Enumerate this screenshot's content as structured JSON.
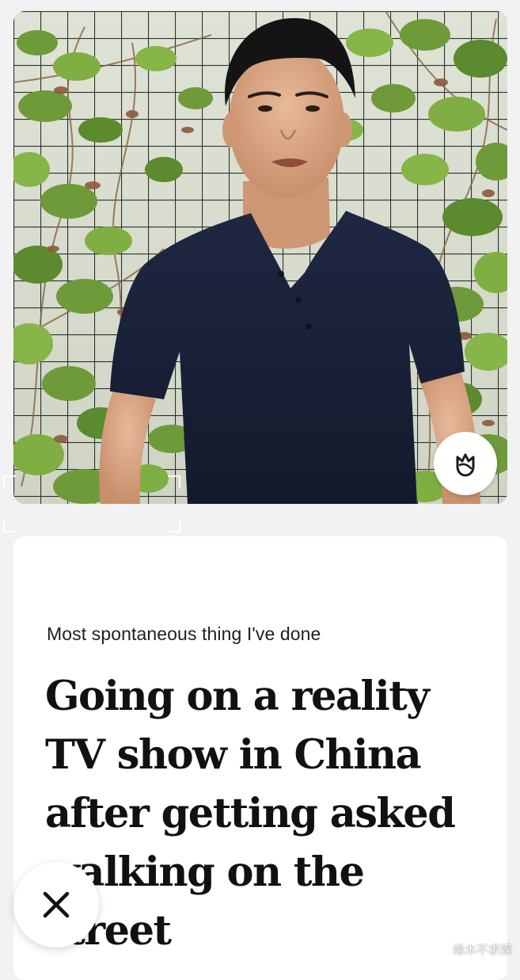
{
  "profile": {
    "photo": {
      "description_icon": "profile-photo",
      "like_icon": "rose-icon"
    },
    "prompt": {
      "question": "Most spontaneous thing I've done",
      "answer": "Going on a reality TV show in China after getting asked walking on the street"
    }
  },
  "actions": {
    "dismiss_icon": "x-icon"
  },
  "watermark": {
    "text": "缘木不求娱"
  },
  "colors": {
    "background": "#f2f2f2",
    "card": "#ffffff",
    "text": "#111111",
    "shirt": "#1b2237",
    "foliage": "#6f9a3a"
  }
}
